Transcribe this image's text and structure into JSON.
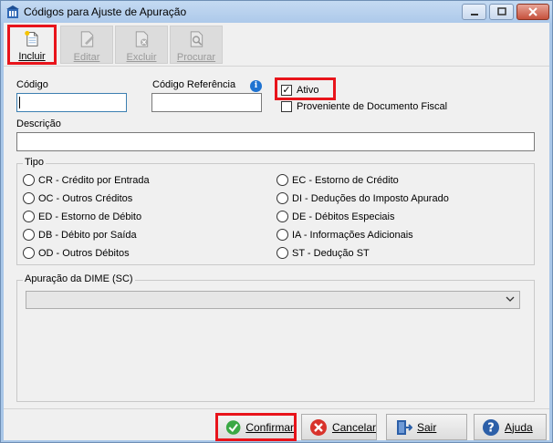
{
  "window": {
    "title": "Códigos para Ajuste de Apuração"
  },
  "toolbar": {
    "incluir": "Incluir",
    "editar": "Editar",
    "excluir": "Excluir",
    "procurar": "Procurar"
  },
  "form": {
    "codigo_label": "Código",
    "codigo_value": "",
    "codigo_ref_label": "Código Referência",
    "codigo_ref_value": "",
    "ativo_label": "Ativo",
    "ativo_checked": true,
    "proveniente_label": "Proveniente de Documento Fiscal",
    "proveniente_checked": false,
    "descricao_label": "Descrição",
    "descricao_value": ""
  },
  "tipo": {
    "title": "Tipo",
    "left": [
      "CR - Crédito por Entrada",
      "OC - Outros Créditos",
      "ED - Estorno de Débito",
      "DB - Débito por Saída",
      "OD - Outros Débitos"
    ],
    "right": [
      "EC - Estorno de Crédito",
      "DI - Deduções do Imposto Apurado",
      "DE - Débitos Especiais",
      "IA - Informações Adicionais",
      "ST - Dedução ST"
    ]
  },
  "dime": {
    "title": "Apuração da DIME (SC)",
    "selected": ""
  },
  "footer": {
    "confirmar": "Confirmar",
    "cancelar": "Cancelar",
    "sair": "Sair",
    "ajuda": "Ajuda"
  }
}
